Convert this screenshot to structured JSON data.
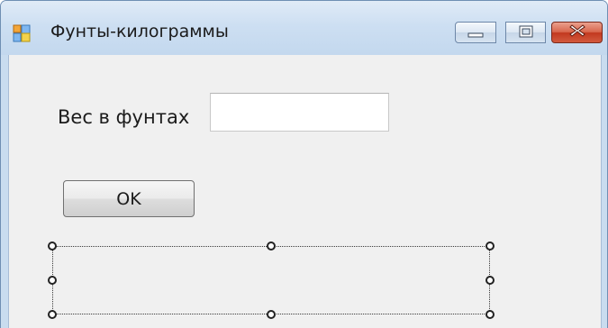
{
  "window": {
    "title": "Фунты-килограммы",
    "icon": "winforms-form-icon",
    "controls": {
      "minimize": "minimize-icon",
      "maximize": "maximize-icon",
      "close": "close-icon"
    }
  },
  "form": {
    "weight_label": "Вес в фунтах",
    "weight_input_value": "",
    "ok_button": "OK"
  },
  "colors": {
    "titlebar": "#cddff2",
    "client_background": "#f0f0f0",
    "close_button": "#c2391f"
  }
}
